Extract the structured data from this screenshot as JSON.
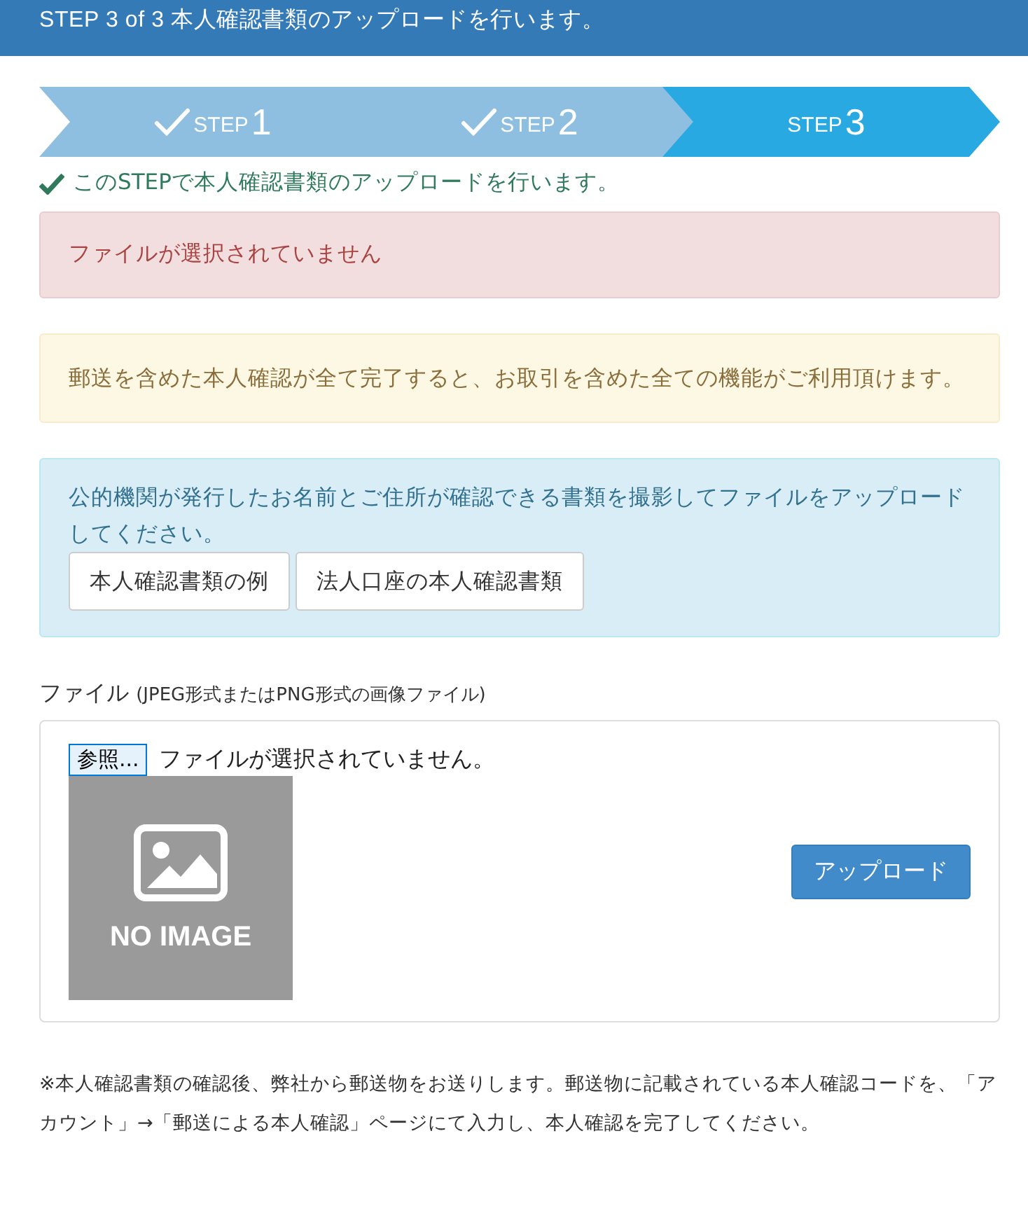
{
  "header": {
    "title": "STEP 3 of 3 本人確認書類のアップロードを行います。"
  },
  "steps": [
    {
      "label": "STEP",
      "number": "1",
      "completed": true,
      "selected": false
    },
    {
      "label": "STEP",
      "number": "2",
      "completed": true,
      "selected": false
    },
    {
      "label": "STEP",
      "number": "3",
      "completed": false,
      "selected": true
    }
  ],
  "step_note": "このSTEPで本人確認書類のアップロードを行います。",
  "alerts": [
    {
      "kind": "danger",
      "text": "ファイルが選択されていません"
    },
    {
      "kind": "warning",
      "text": "郵送を含めた本人確認が全て完了すると、お取引を含めた全ての機能がご利用頂けます。"
    },
    {
      "kind": "info",
      "text": "公的機関が発行したお名前とご住所が確認できる書類を撮影してファイルをアップロードしてください。",
      "buttons": [
        "本人確認書類の例",
        "法人口座の本人確認書類"
      ]
    }
  ],
  "file": {
    "label": "ファイル",
    "hint": "(JPEG形式またはPNG形式の画像ファイル)",
    "browse_button": "参照...",
    "status": "ファイルが選択されていません。",
    "preview_text": "NO IMAGE",
    "upload_button": "アップロード"
  },
  "footnote": "※本人確認書類の確認後、弊社から郵送物をお送りします。郵送物に記載されている本人確認コードを、「アカウント」→「郵送による本人確認」ページにて入力し、本人確認を完了してください。"
}
